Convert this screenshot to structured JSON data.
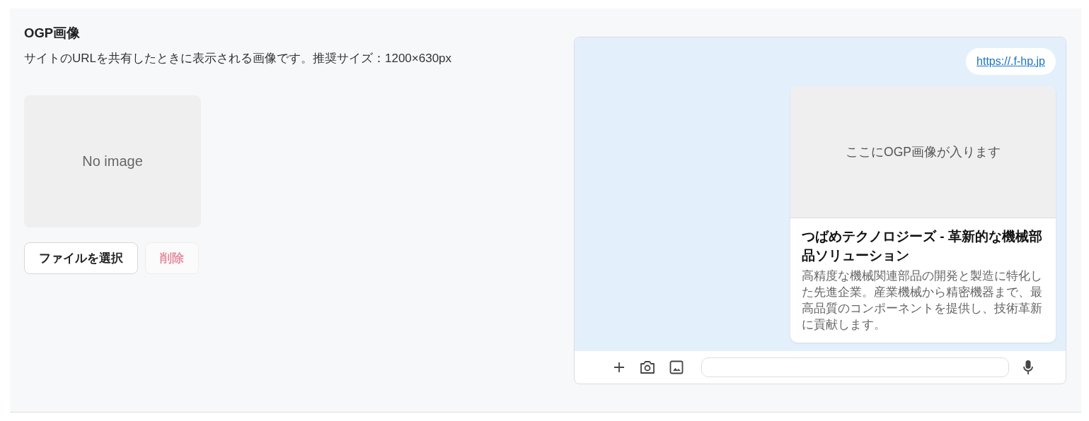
{
  "section": {
    "title": "OGP画像",
    "description": "サイトのURLを共有したときに表示される画像です。推奨サイズ：1200×630px"
  },
  "image_box": {
    "placeholder": "No image"
  },
  "buttons": [
    {
      "kind": "primary",
      "label": "ファイルを選択",
      "disabled": false
    },
    {
      "kind": "danger",
      "label": "削除",
      "disabled": true
    }
  ],
  "preview": {
    "url": "https://.f-hp.jp",
    "image_placeholder": "ここにOGP画像が入ります",
    "card_title": "つばめテクノロジーズ - 革新的な機械部品ソリューション",
    "card_description": "高精度な機械関連部品の開発と製造に特化した先進企業。産業機械から精密機器まで、最高品質のコンポーネントを提供し、技術革新に貢献します。"
  }
}
